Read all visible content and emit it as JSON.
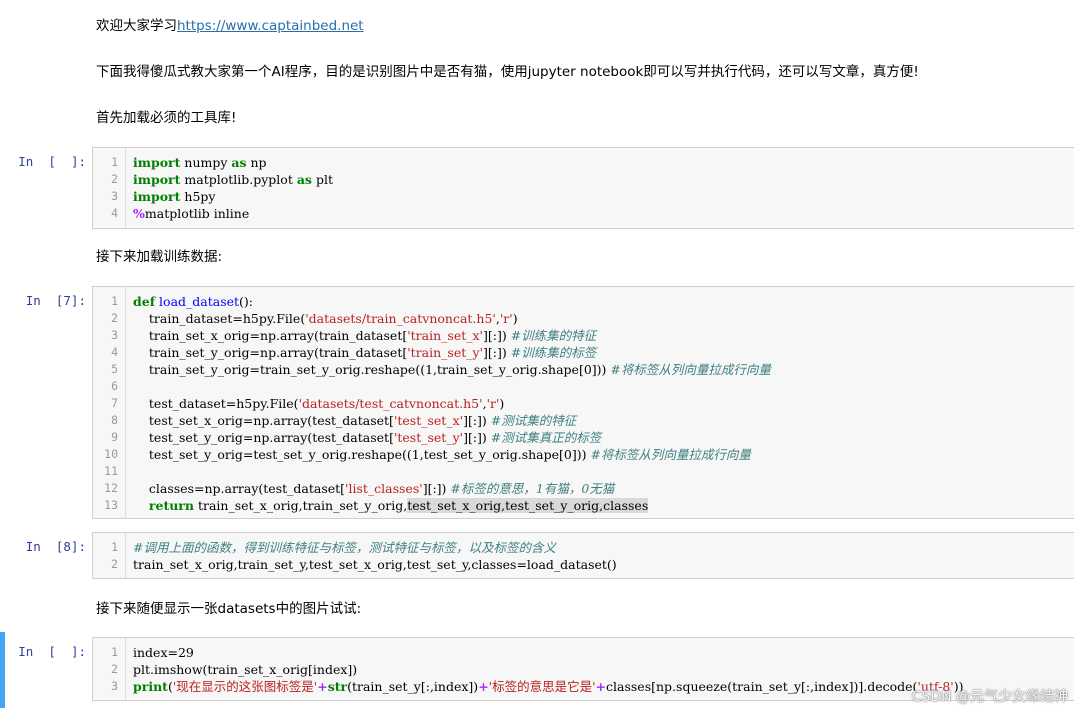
{
  "markdown": {
    "welcome_prefix": "欢迎大家学习",
    "welcome_link": "https://www.captainbed.net",
    "intro": "下面我得傻瓜式教大家第一个AI程序，目的是识别图片中是否有猫，使用jupyter notebook即可以写并执行代码，还可以写文章，真方便!",
    "load_libs": "首先加载必须的工具库!",
    "load_data": "接下来加载训练数据:",
    "show_image": "接下来随便显示一张datasets中的图片试试:"
  },
  "cells": {
    "c1": {
      "prompt": "In  [  ]:"
    },
    "c2": {
      "prompt": "In  [7]:"
    },
    "c3": {
      "prompt": "In  [8]:"
    },
    "c4": {
      "prompt": "In  [  ]:"
    }
  },
  "line_numbers": [
    "1",
    "2",
    "3",
    "4",
    "5",
    "6",
    "7",
    "8",
    "9",
    "10",
    "11",
    "12",
    "13"
  ],
  "code": {
    "c1": {
      "l1_kw": "import",
      "l1_rest": " numpy ",
      "l1_as": "as",
      "l1_tail": " np",
      "l2_kw": "import",
      "l2_rest": " matplotlib.pyplot ",
      "l2_as": "as",
      "l2_tail": " plt",
      "l3_kw": "import",
      "l3_rest": " h5py",
      "l4_op": "%",
      "l4_rest": "matplotlib inline"
    },
    "c2": {
      "l1_kw": "def",
      "l1_fn": " load_dataset",
      "l1_rest": "():",
      "l2_a": "    train_dataset=h5py.File(",
      "l2_s1": "'datasets/train_catvnoncat.h5'",
      "l2_c": ",",
      "l2_s2": "'r'",
      "l2_e": ")",
      "l3_a": "    train_set_x_orig=np.array(train_dataset[",
      "l3_s": "'train_set_x'",
      "l3_b": "][:]) ",
      "l3_cm": "#训练集的特征",
      "l4_a": "    train_set_y_orig=np.array(train_dataset[",
      "l4_s": "'train_set_y'",
      "l4_b": "][:]) ",
      "l4_cm": "#训练集的标签",
      "l5_a": "    train_set_y_orig=train_set_y_orig.reshape((1,train_set_y_orig.shape[0])) ",
      "l5_cm": "#将标签从列向量拉成行向量",
      "l7_a": "    test_dataset=h5py.File(",
      "l7_s1": "'datasets/test_catvnoncat.h5'",
      "l7_c": ",",
      "l7_s2": "'r'",
      "l7_e": ")",
      "l8_a": "    test_set_x_orig=np.array(test_dataset[",
      "l8_s": "'test_set_x'",
      "l8_b": "][:]) ",
      "l8_cm": "#测试集的特征",
      "l9_a": "    test_set_y_orig=np.array(test_dataset[",
      "l9_s": "'test_set_y'",
      "l9_b": "][:]) ",
      "l9_cm": "#测试集真正的标签",
      "l10_a": "    test_set_y_orig=test_set_y_orig.reshape((1,test_set_y_orig.shape[0])) ",
      "l10_cm": "#将标签从列向量拉成行向量",
      "l12_a": "    classes=np.array(test_dataset[",
      "l12_s": "'list_classes'",
      "l12_b": "][:]) ",
      "l12_cm": "#标签的意思，1有猫，0无猫",
      "l13_ind": "    ",
      "l13_kw": "return",
      "l13_a": " train_set_x_orig,train_set_y_orig,",
      "l13_sel": "test_set_x_orig,test_set_y_orig,classes"
    },
    "c3": {
      "l1_cm": "#调用上面的函数，得到训练特征与标签，测试特征与标签，以及标签的含义",
      "l2": "train_set_x_orig,train_set_y,test_set_x_orig,test_set_y,classes=load_dataset()"
    },
    "c4": {
      "l1": "index=29",
      "l2": "plt.imshow(train_set_x_orig[index])",
      "l3_fn": "print",
      "l3_a": "(",
      "l3_s1": "'现在显示的这张图标签是'",
      "l3_op1": "+",
      "l3_fn2": "str",
      "l3_b": "(train_set_y[:,index])",
      "l3_op2": "+",
      "l3_s2": "'标签的意思是它是'",
      "l3_op3": "+",
      "l3_c": "classes[np.squeeze(train_set_y[:,index])].decode(",
      "l3_s3": "'utf-8'",
      "l3_e": "))"
    }
  },
  "watermark": "CSDN @元气少女缘结神"
}
